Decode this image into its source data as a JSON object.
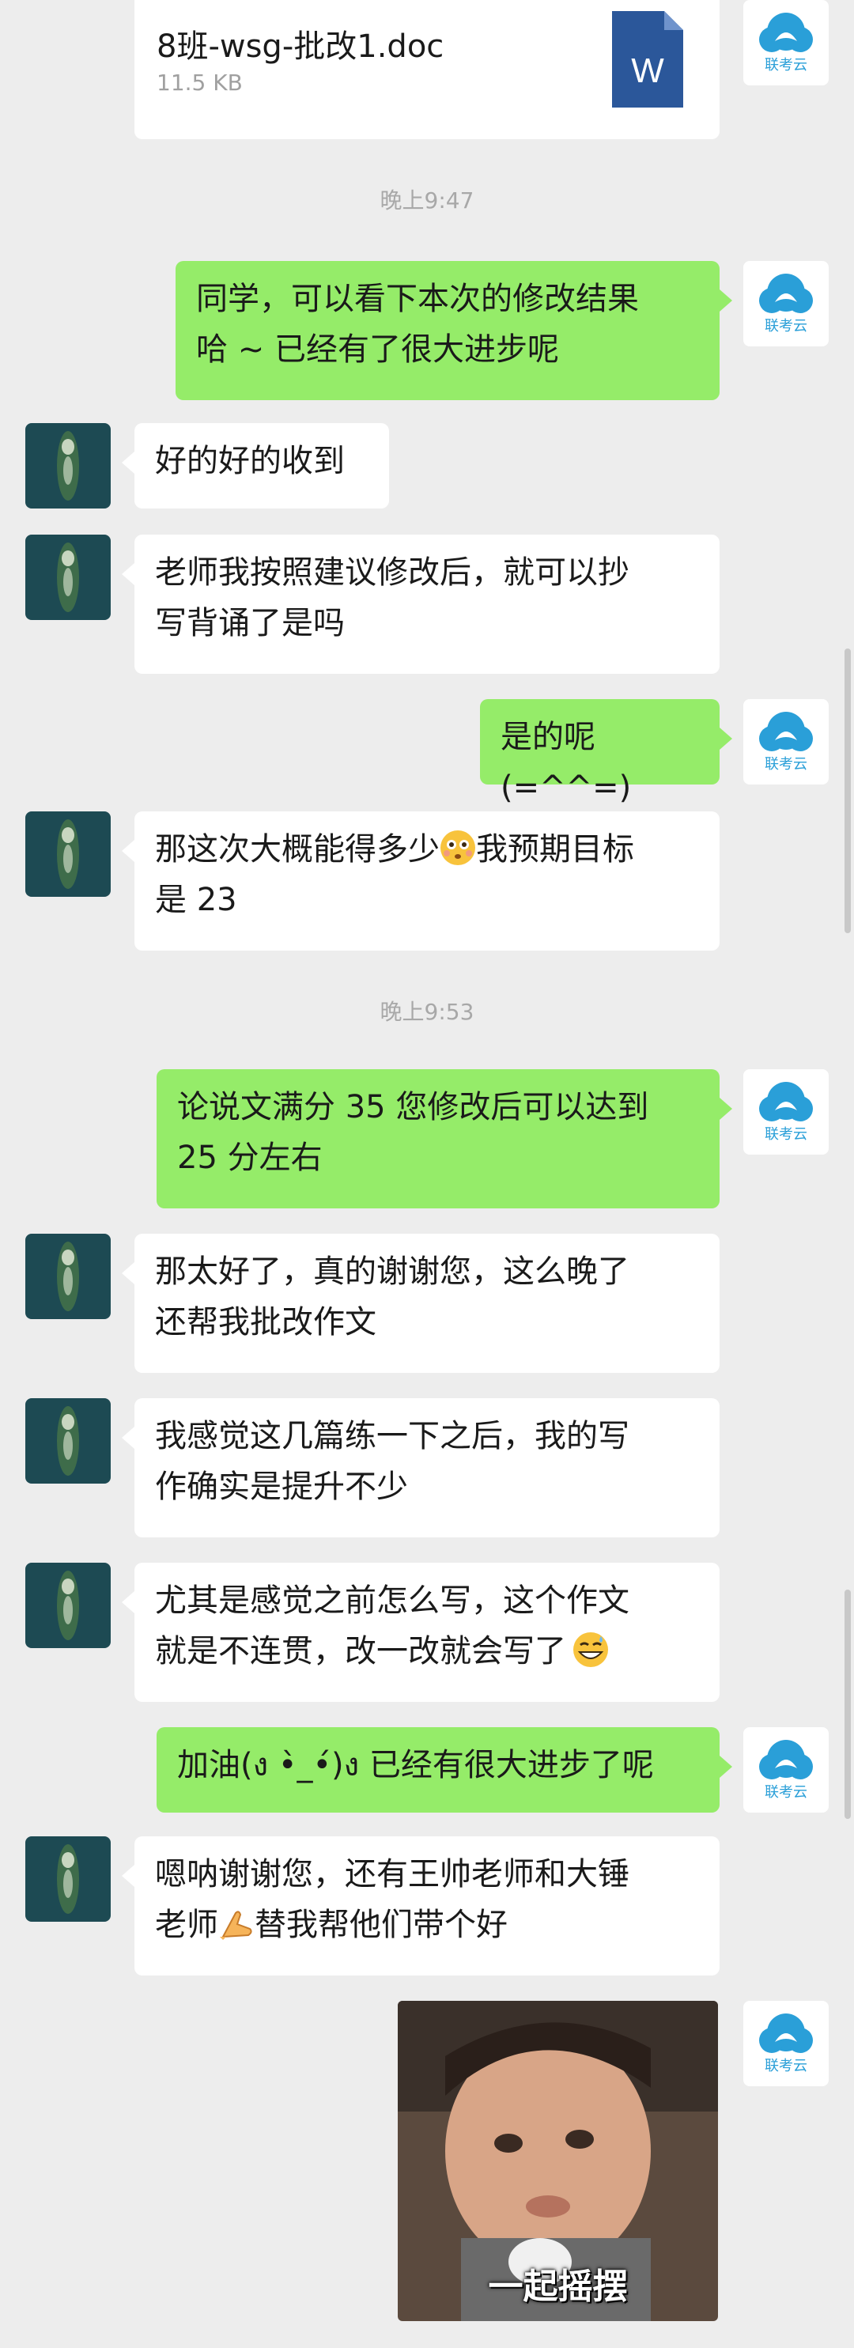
{
  "file": {
    "name": "8班-wsg-批改1.doc",
    "size": "11.5 KB",
    "icon": "W"
  },
  "times": {
    "t1": "晚上9:47",
    "t2": "晚上9:53"
  },
  "teacher_avatar_text": "联考云",
  "messages": [
    {
      "line1": "同学，可以看下本次的修改结果",
      "line2": "哈 ~ 已经有了很大进步呢"
    },
    {
      "line1": "好的好的收到"
    },
    {
      "line1": "老师我按照建议修改后，就可以抄",
      "line2": "写背诵了是吗"
    },
    {
      "line1": "是的呢(=^^=)"
    },
    {
      "line1a": "那这次大概能得多少",
      "line1b": "我预期目标",
      "line2": "是 23"
    },
    {
      "line1": "论说文满分 35 您修改后可以达到",
      "line2": "25 分左右"
    },
    {
      "line1": "那太好了，真的谢谢您，这么晚了",
      "line2": "还帮我批改作文"
    },
    {
      "line1": "我感觉这几篇练一下之后，我的写",
      "line2": "作确实是提升不少"
    },
    {
      "line1": "尤其是感觉之前怎么写，这个作文",
      "line2": "就是不连贯，改一改就会写了"
    },
    {
      "line1": "加油(ง •̀_•́)ง  已经有很大进步了呢"
    },
    {
      "line1": "嗯呐谢谢您，还有王帅老师和大锤",
      "line2a": "老师",
      "line2b": "替我帮他们带个好"
    }
  ],
  "sticker": {
    "caption": "一起摇摆"
  },
  "colors": {
    "background": "#ededed",
    "sent_bubble": "#95ec69",
    "received_bubble": "#ffffff"
  }
}
